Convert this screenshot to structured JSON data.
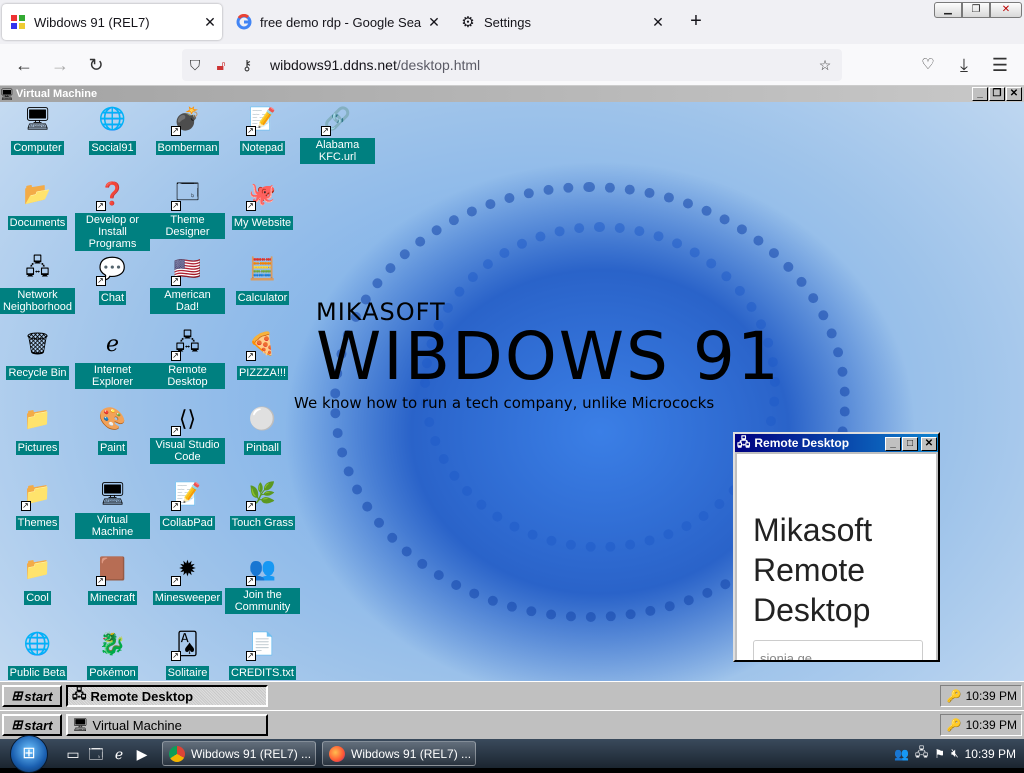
{
  "browser": {
    "tabs": [
      {
        "label": "Wibdows 91 (REL7)",
        "icon": "wibdows-favicon",
        "active": true
      },
      {
        "label": "free demo rdp - Google Search",
        "icon": "google-icon",
        "active": false
      },
      {
        "label": "Settings",
        "icon": "gear-icon",
        "active": false
      }
    ],
    "new_tab": "+",
    "url_host": "wibdows91.ddns.net",
    "url_path": "/desktop.html"
  },
  "vm_window": {
    "title": "Virtual Machine"
  },
  "desktop": {
    "icons": [
      {
        "label": "Computer",
        "icon": "computer-icon",
        "glyph": "🖥"
      },
      {
        "label": "Social91",
        "icon": "globe-icon",
        "glyph": "🌐"
      },
      {
        "label": "Bomberman",
        "icon": "bomberman-icon",
        "glyph": "💣"
      },
      {
        "label": "Notepad",
        "icon": "notepad-icon",
        "glyph": "📝"
      },
      {
        "label": "Alabama KFC.url",
        "icon": "ie-shortcut-icon",
        "glyph": "🔗"
      },
      {
        "label": "Documents",
        "icon": "folder-icon",
        "glyph": "📂"
      },
      {
        "label": "Develop or Install Programs",
        "icon": "help-icon",
        "glyph": "❓"
      },
      {
        "label": "Theme Designer",
        "icon": "window-icon",
        "glyph": "🗔"
      },
      {
        "label": "My Website",
        "icon": "github-icon",
        "glyph": "🐙"
      },
      {
        "label": "Network Neighborhood",
        "icon": "network-icon",
        "glyph": "🖧"
      },
      {
        "label": "Chat",
        "icon": "chat-icon",
        "glyph": "💬"
      },
      {
        "label": "American Dad!",
        "icon": "flag-icon",
        "glyph": "🇺🇸"
      },
      {
        "label": "Calculator",
        "icon": "calculator-icon",
        "glyph": "🧮"
      },
      {
        "label": "Recycle Bin",
        "icon": "recycle-bin-icon",
        "glyph": "🗑"
      },
      {
        "label": "Internet Explorer",
        "icon": "ie-icon",
        "glyph": "ℯ"
      },
      {
        "label": "Remote Desktop",
        "icon": "remote-desktop-icon",
        "glyph": "🖧"
      },
      {
        "label": "PIZZZA!!!",
        "icon": "pizza-icon",
        "glyph": "🍕"
      },
      {
        "label": "Pictures",
        "icon": "folder-icon",
        "glyph": "📁"
      },
      {
        "label": "Paint",
        "icon": "paint-icon",
        "glyph": "🎨"
      },
      {
        "label": "Visual Studio Code",
        "icon": "vscode-icon",
        "glyph": "⟨⟩"
      },
      {
        "label": "Pinball",
        "icon": "pinball-icon",
        "glyph": "⚪"
      },
      {
        "label": "Themes",
        "icon": "folder-icon",
        "glyph": "📁"
      },
      {
        "label": "Virtual Machine",
        "icon": "computer-icon",
        "glyph": "🖥"
      },
      {
        "label": "CollabPad",
        "icon": "collabpad-icon",
        "glyph": "📝"
      },
      {
        "label": "Touch Grass",
        "icon": "grass-icon",
        "glyph": "🌿"
      },
      {
        "label": "Cool",
        "icon": "folder-icon",
        "glyph": "📁"
      },
      {
        "label": "Minecraft",
        "icon": "minecraft-icon",
        "glyph": "🟫"
      },
      {
        "label": "Minesweeper",
        "icon": "mine-icon",
        "glyph": "✹"
      },
      {
        "label": "Join the Community",
        "icon": "people-icon",
        "glyph": "👥"
      },
      {
        "label": "Public Beta",
        "icon": "globe-icon",
        "glyph": "🌐"
      },
      {
        "label": "Pokémon",
        "icon": "pokemon-icon",
        "glyph": "🐉"
      },
      {
        "label": "Solitaire",
        "icon": "cards-icon",
        "glyph": "🂡"
      },
      {
        "label": "CREDITS.txt",
        "icon": "text-file-icon",
        "glyph": "📄"
      }
    ],
    "brand_small": "MIKASOFT",
    "brand_big": "WIBDOWS 91",
    "brand_tagline": "We know how to run a tech company, unlike Micrococks"
  },
  "remote_desktop": {
    "title": "Remote Desktop",
    "heading": "Mikasoft Remote Desktop",
    "input_value": "sionia.ge"
  },
  "taskbar_inner": {
    "start": "start",
    "task": "Remote Desktop",
    "clock": "10:39 PM"
  },
  "taskbar_outer": {
    "start": "start",
    "task": "Virtual Machine",
    "clock": "10:39 PM"
  },
  "win7_taskbar": {
    "tasks": [
      {
        "label": "Wibdows 91 (REL7) ...",
        "icon": "chrome-icon"
      },
      {
        "label": "Wibdows 91 (REL7) ...",
        "icon": "firefox-icon"
      }
    ],
    "clock": "10:39 PM"
  },
  "colors": {
    "desktop_label_bg": "#008080",
    "titlebar_active": "#000080",
    "w95_face": "#c0c0c0"
  }
}
